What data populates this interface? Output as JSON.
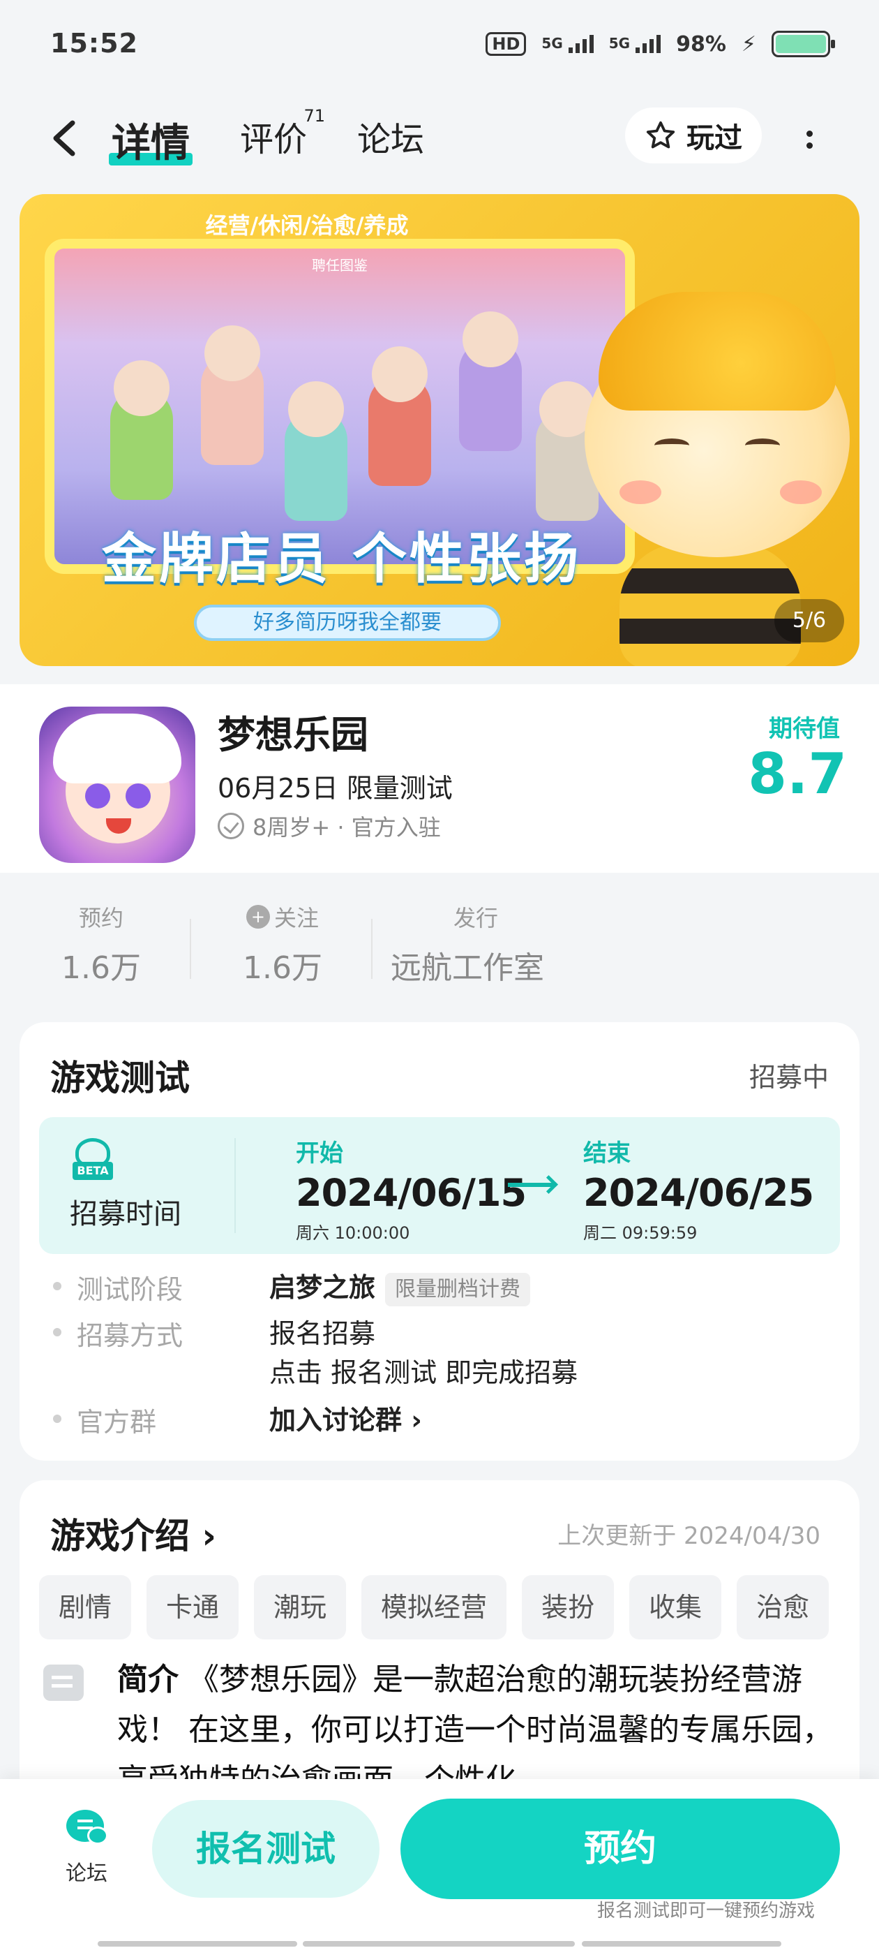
{
  "status_bar": {
    "time": "15:52",
    "hd": "HD",
    "net1": "5G",
    "net2": "5G",
    "battery": "98%"
  },
  "nav": {
    "tabs": [
      {
        "label": "详情"
      },
      {
        "label": "评价",
        "count": "71"
      },
      {
        "label": "论坛"
      }
    ],
    "played_label": "玩过"
  },
  "banner": {
    "tags": "经营/休闲/治愈/养成",
    "stage_title": "聘任图鉴",
    "slogan": "金牌店员 个性张扬",
    "sub_slogan": "好多简历呀我全都要",
    "page_indicator": "5/6"
  },
  "game": {
    "name": "梦想乐园",
    "date_status": "06月25日 限量测试",
    "age_info": "8周岁+ · 官方入驻",
    "expect_label": "期待值",
    "expect_value": "8.7"
  },
  "stats": [
    {
      "label": "预约",
      "value": "1.6万"
    },
    {
      "label": "关注",
      "value": "1.6万"
    },
    {
      "label": "发行",
      "value": "远航工作室"
    }
  ],
  "test": {
    "title": "游戏测试",
    "status": "招募中",
    "beta_tag": "BETA",
    "time_label": "招募时间",
    "start": {
      "key": "开始",
      "date": "2024/06/15",
      "weekday": "周六  10:00:00"
    },
    "end": {
      "key": "结束",
      "date": "2024/06/25",
      "weekday": "周二  09:59:59"
    },
    "rows": [
      {
        "key": "测试阶段",
        "value": "启梦之旅",
        "badge": "限量删档计费"
      },
      {
        "key": "招募方式",
        "value": "报名招募",
        "value2": "点击 报名测试 即完成招募"
      },
      {
        "key": "官方群",
        "value": "加入讨论群 ›"
      }
    ]
  },
  "intro": {
    "title": "游戏介绍 ›",
    "updated": "上次更新于 2024/04/30",
    "tags": [
      "剧情",
      "卡通",
      "潮玩",
      "模拟经营",
      "装扮",
      "收集",
      "治愈"
    ],
    "lead": "简介",
    "text": "《梦想乐园》是一款超治愈的潮玩装扮经营游戏！ 在这里，你可以打造一个时尚温馨的专属乐园，享受独特的治愈画面、个性化…"
  },
  "bottom": {
    "forum_label": "论坛",
    "signup_label": "报名测试",
    "reserve_label": "预约",
    "hint": "报名测试即可一键预约游戏"
  },
  "colors": {
    "accent": "#14d4c3",
    "accent_dark": "#11b9aa",
    "banner_yellow": "#f7c531",
    "link_blue": "#1a6aa8"
  }
}
